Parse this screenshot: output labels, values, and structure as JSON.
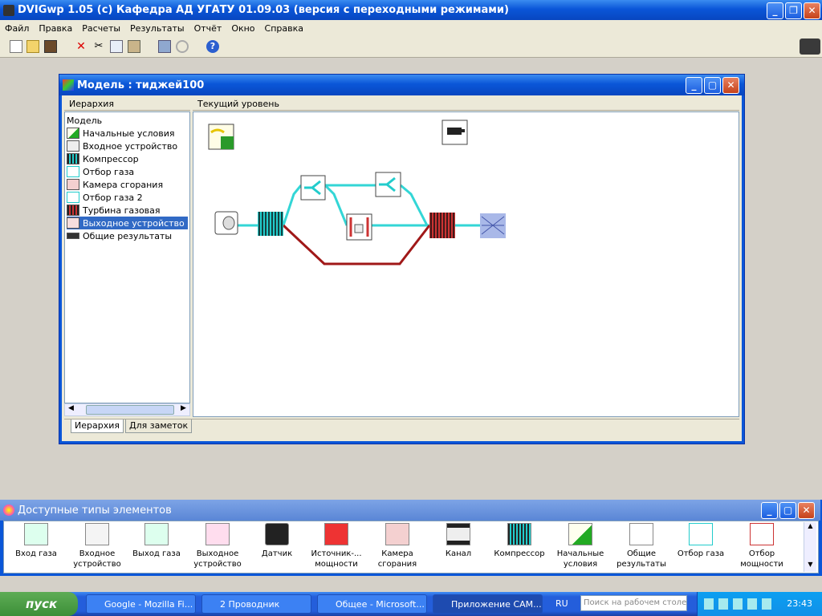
{
  "app": {
    "title": "DVIGwp 1.05 (c) Кафедра АД УГАТУ 01.09.03 (версия с переходными режимами)"
  },
  "menu": [
    "Файл",
    "Правка",
    "Расчеты",
    "Результаты",
    "Отчёт",
    "Окно",
    "Справка"
  ],
  "model_window": {
    "title": "Модель : тиджей100",
    "hierarchy_header": "Иерархия",
    "level_header": "Текущий уровень",
    "tree_root": "Модель",
    "tree_items": [
      "Начальные условия",
      "Входное устройство",
      "Компрессор",
      "Отбор газа",
      "Камера сгорания",
      "Отбор газа 2",
      "Турбина газовая",
      "Выходное устройство",
      "Общие результаты"
    ],
    "selected_index": 7,
    "tabs": [
      "Иерархия",
      "Для заметок"
    ]
  },
  "palette": {
    "title": "Доступные типы элементов",
    "items": [
      {
        "label": "Вход газа"
      },
      {
        "label": "Входное устройство"
      },
      {
        "label": "Выход газа"
      },
      {
        "label": "Выходное устройство"
      },
      {
        "label": "Датчик"
      },
      {
        "label": "Источник-... мощности"
      },
      {
        "label": "Камера сгорания"
      },
      {
        "label": "Канал"
      },
      {
        "label": "Компрессор"
      },
      {
        "label": "Начальные условия"
      },
      {
        "label": "Общие результаты"
      },
      {
        "label": "Отбор газа"
      },
      {
        "label": "Отбор мощности"
      }
    ]
  },
  "taskbar": {
    "start": "пуск",
    "tasks": [
      "Google - Mozilla Fi...",
      "2 Проводник",
      "Общее - Microsoft...",
      "Приложение CAM..."
    ],
    "lang": "RU",
    "search_placeholder": "Поиск на рабочем столе",
    "clock": "23:43"
  },
  "colors": {
    "gas_line": "#33d6d6",
    "shaft_line": "#a01818",
    "selection": "#316ac5"
  }
}
